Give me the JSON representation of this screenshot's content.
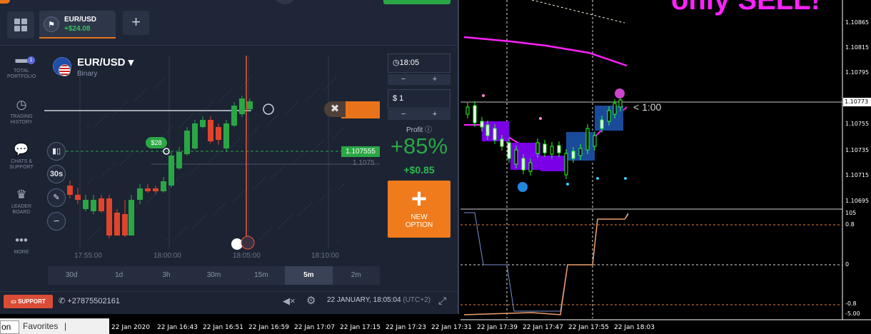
{
  "app": {
    "tab": {
      "name": "EUR/USD",
      "profit": "+$24.08"
    },
    "nav": [
      {
        "label": "TOTAL PORTFOLIO",
        "icon": "briefcase-icon",
        "badge": "1"
      },
      {
        "label": "TRADING HISTORY",
        "icon": "history-icon"
      },
      {
        "label": "CHATS & SUPPORT",
        "icon": "chat-icon"
      },
      {
        "label": "LEADER BOARD",
        "icon": "trophy-icon"
      },
      {
        "label": "MORE",
        "icon": "more-icon"
      }
    ],
    "asset": {
      "title": "EUR/USD",
      "type": "Binary"
    },
    "chart": {
      "price_tag": "1.107555",
      "price_grey": "1.1075",
      "deal_badge": "$28",
      "period_label": "30s",
      "time_labels": [
        "17:55:00",
        "18:00:00",
        "18:05:00",
        "18:10:00"
      ]
    },
    "timeframes": [
      "30d",
      "1d",
      "3h",
      "30m",
      "15m",
      "5m",
      "2m"
    ],
    "active_timeframe": "5m",
    "panel": {
      "time": "18:05",
      "amount": "$ 1",
      "profit_label": "Profit",
      "profit_pct": "+85%",
      "profit_amt": "+$0.85",
      "new_option_line1": "NEW",
      "new_option_line2": "OPTION"
    },
    "bottom": {
      "support": "SUPPORT",
      "phone": "+27875502161",
      "datetime": "22 JANUARY, 18:05:04",
      "timezone": "(UTC+2)"
    }
  },
  "mt4": {
    "headline": "only SELL!",
    "expiry": "< 1:00",
    "current_price": "1.10773",
    "price_axis": [
      "1.10865",
      "1.10815",
      "1.10795",
      "1.10755",
      "1.10735",
      "1.10715",
      "1.10695"
    ],
    "indicator_axis": [
      "105",
      "0.8",
      "0",
      "-0.8",
      "-5.00"
    ],
    "time_axis": [
      "22 Jan 2020",
      "22 Jan 16:43",
      "22 Jan 16:51",
      "22 Jan 16:59",
      "22 Jan 17:07",
      "22 Jan 17:15",
      "22 Jan 17:23",
      "22 Jan 17:31",
      "22 Jan 17:39",
      "22 Jan 17:47",
      "22 Jan 17:55",
      "22 Jan 18:03"
    ]
  },
  "taskbar": {
    "left": "on",
    "favorites": "Favorites"
  },
  "colors": {
    "accent_orange": "#f07b1c",
    "green": "#2aa745",
    "magenta": "#ff22ff",
    "panel_bg": "#1c2333"
  }
}
